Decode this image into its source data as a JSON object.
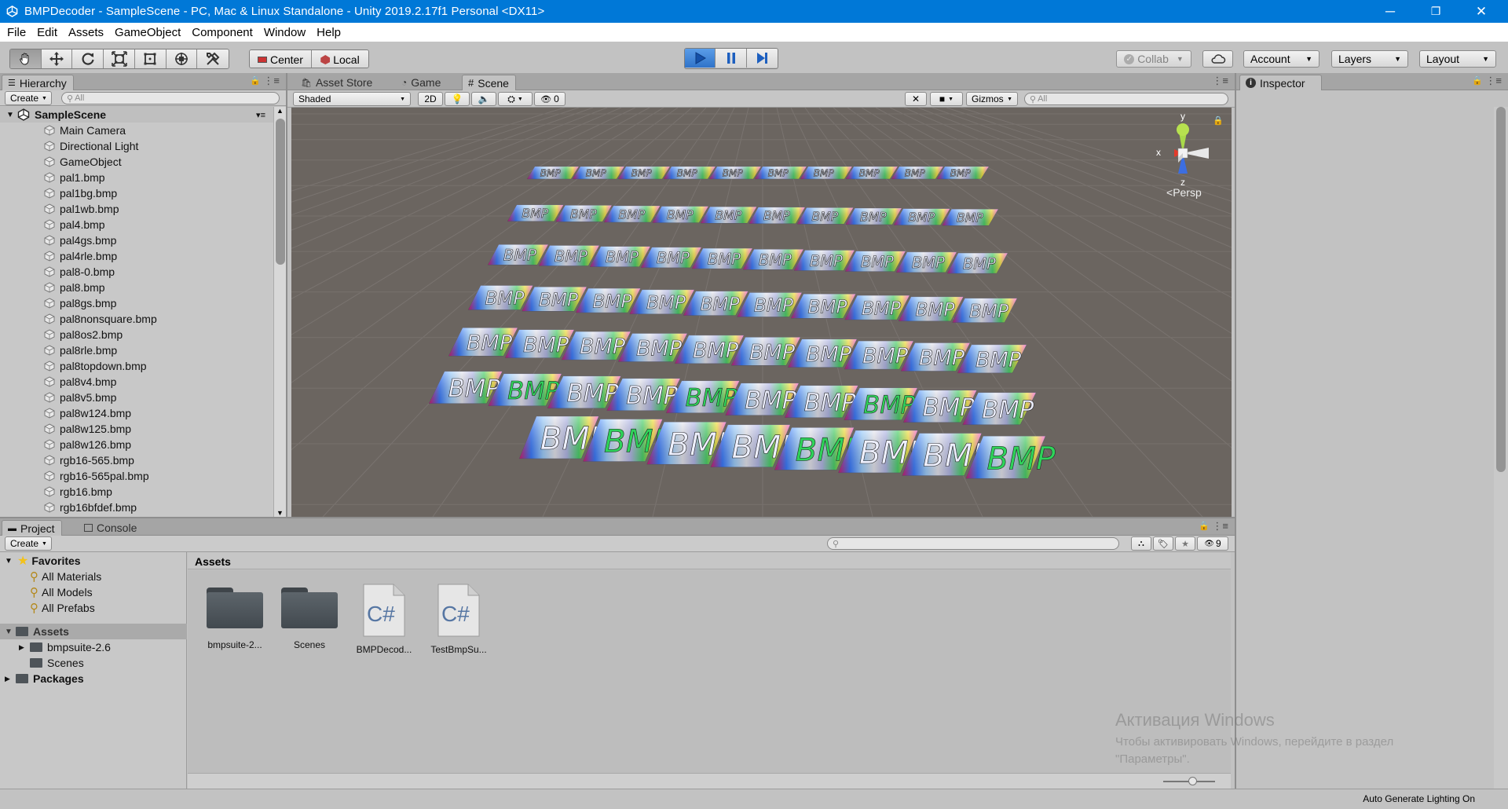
{
  "window": {
    "title": "BMPDecoder - SampleScene - PC, Mac & Linux Standalone - Unity 2019.2.17f1 Personal <DX11>",
    "controls": {
      "minimize": "─",
      "restore": "❐",
      "close": "✕"
    }
  },
  "menu": [
    "File",
    "Edit",
    "Assets",
    "GameObject",
    "Component",
    "Window",
    "Help"
  ],
  "toolbar": {
    "pivot_center": "Center",
    "pivot_local": "Local",
    "collab": "Collab",
    "account": "Account",
    "layers": "Layers",
    "layout": "Layout",
    "active_tool": "hand",
    "playing": true
  },
  "hierarchy": {
    "tab": "Hierarchy",
    "create": "Create",
    "search_placeholder": "All",
    "scene": "SampleScene",
    "items": [
      "Main Camera",
      "Directional Light",
      "GameObject",
      "pal1.bmp",
      "pal1bg.bmp",
      "pal1wb.bmp",
      "pal4.bmp",
      "pal4gs.bmp",
      "pal4rle.bmp",
      "pal8-0.bmp",
      "pal8.bmp",
      "pal8gs.bmp",
      "pal8nonsquare.bmp",
      "pal8os2.bmp",
      "pal8rle.bmp",
      "pal8topdown.bmp",
      "pal8v4.bmp",
      "pal8v5.bmp",
      "pal8w124.bmp",
      "pal8w125.bmp",
      "pal8w126.bmp",
      "rgb16-565.bmp",
      "rgb16-565pal.bmp",
      "rgb16.bmp",
      "rgb16bfdef.bmp"
    ]
  },
  "center_tabs": {
    "asset_store": "Asset Store",
    "game": "Game",
    "scene": "Scene"
  },
  "scene_toolbar": {
    "shading": "Shaded",
    "mode_2d": "2D",
    "hidden_count": "0",
    "gizmos": "Gizmos",
    "search_placeholder": "All"
  },
  "scene_gizmo": {
    "x": "x",
    "y": "y",
    "z": "z",
    "projection": "Persp"
  },
  "scene_content": {
    "texture_label": "BMP",
    "strips": [
      {
        "tiles": 10
      },
      {
        "tiles": 10
      },
      {
        "tiles": 10
      },
      {
        "tiles": 10
      },
      {
        "tiles": 10
      },
      {
        "tiles": 10
      },
      {
        "tiles": 8
      }
    ]
  },
  "inspector": {
    "tab": "Inspector"
  },
  "bottom_tabs": {
    "project": "Project",
    "console": "Console"
  },
  "project": {
    "create": "Create",
    "favorites_label": "Favorites",
    "favorites": [
      "All Materials",
      "All Models",
      "All Prefabs"
    ],
    "assets_label": "Assets",
    "asset_children": [
      "bmpsuite-2.6",
      "Scenes"
    ],
    "packages_label": "Packages",
    "breadcrumb": "Assets",
    "hidden_count": "9",
    "files": [
      {
        "name": "bmpsuite-2...",
        "kind": "folder"
      },
      {
        "name": "Scenes",
        "kind": "folder"
      },
      {
        "name": "BMPDecod...",
        "kind": "script",
        "glyph": "C#"
      },
      {
        "name": "TestBmpSu...",
        "kind": "script",
        "glyph": "C#"
      }
    ]
  },
  "watermark": {
    "line1": "Активация Windows",
    "line2": "Чтобы активировать Windows, перейдите в раздел",
    "line3": "\"Параметры\"."
  },
  "status": {
    "right": "Auto Generate Lighting On"
  },
  "colors": {
    "titlebar": "#0078d7",
    "panel": "#c2c2c2",
    "scene_bg": "#6b6560",
    "play_active": "#4a90e2"
  }
}
